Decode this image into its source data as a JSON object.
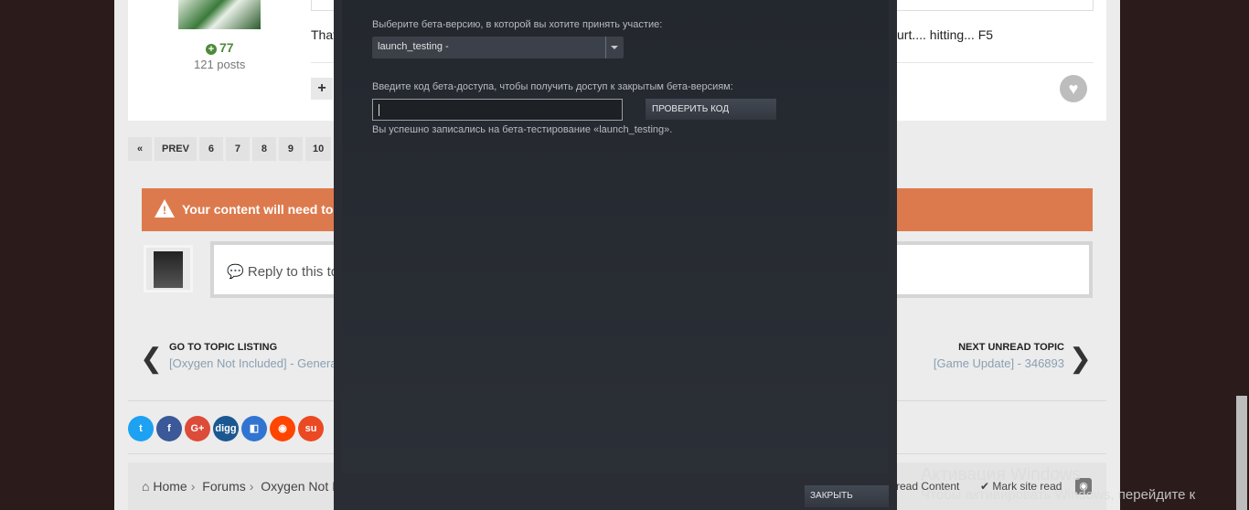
{
  "post": {
    "reputation": "77",
    "post_count": "121 posts",
    "text_left": "That",
    "text_right": "urt.... hitting... F5"
  },
  "pagination": {
    "first_icon": "«",
    "prev": "PREV",
    "pages": [
      "6",
      "7",
      "8",
      "9",
      "10"
    ]
  },
  "warning": {
    "text": "Your content will need to be a"
  },
  "reply": {
    "placeholder": "Reply to this to"
  },
  "topic_nav": {
    "prev_label": "GO TO TOPIC LISTING",
    "prev_sub": "[Oxygen Not Included] - Genera",
    "next_label": "NEXT UNREAD TOPIC",
    "next_sub": "[Game Update] - 346893"
  },
  "share": {
    "icons": [
      "twitter-icon",
      "facebook-icon",
      "googleplus-icon",
      "digg-icon",
      "delicious-icon",
      "reddit-icon",
      "stumbleupon-icon"
    ],
    "glyphs": [
      "t",
      "f",
      "G+",
      "digg",
      "◧",
      "◉",
      "su"
    ],
    "colors": [
      "#1da1f2",
      "#3b5998",
      "#dd4b39",
      "#1b5891",
      "#3274d1",
      "#ff4500",
      "#eb4924"
    ]
  },
  "breadcrumb": {
    "home": "Home",
    "forums": "Forums",
    "section": "Oxygen Not In",
    "unread": "read Content",
    "mark_read": "Mark site read"
  },
  "modal": {
    "beta_label": "Выберите бета-версию, в которой вы хотите принять участие:",
    "beta_selected": "launch_testing -",
    "code_label": "Введите код бета-доступа, чтобы получить доступ к закрытым бета-версиям:",
    "code_value": "",
    "check_button": "ПРОВЕРИТЬ КОД",
    "success_text": "Вы успешно записались на бета-тестирование «launch_testing».",
    "close_button": "ЗАКРЫТЬ"
  },
  "watermark": {
    "line1": "Активация Windows",
    "line2": "Чтобы активировать Windows, перейдите к"
  }
}
